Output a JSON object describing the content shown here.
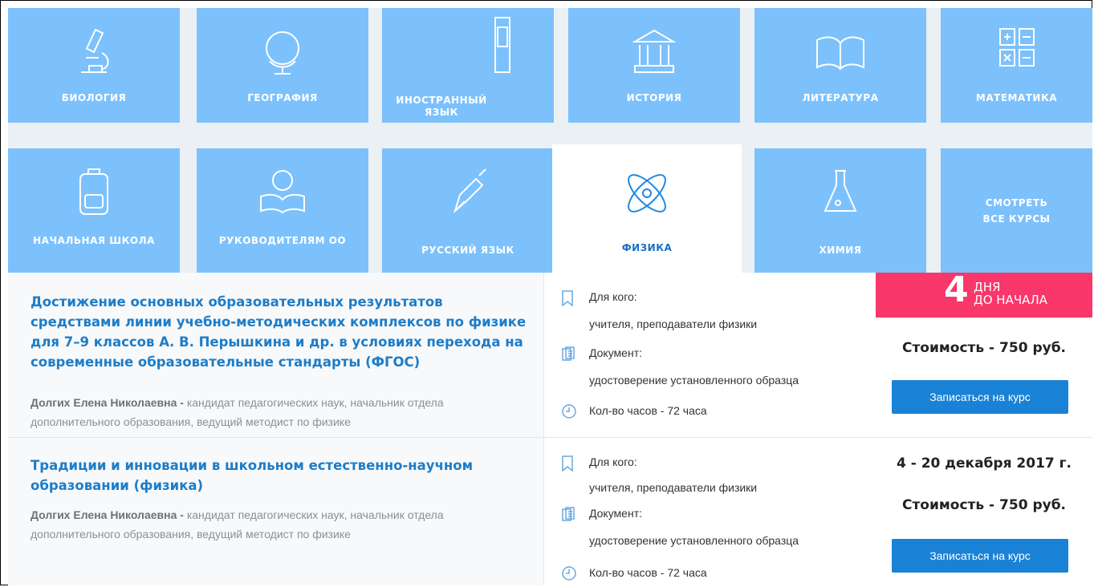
{
  "categories": [
    {
      "label": "БИОЛОГИЯ",
      "icon": "microscope-icon"
    },
    {
      "label": "ГЕОГРАФИЯ",
      "icon": "globe-icon"
    },
    {
      "label": "ИНОСТРАННЫЙ ЯЗЫК",
      "icon": "phone-booth-icon"
    },
    {
      "label": "ИСТОРИЯ",
      "icon": "museum-icon"
    },
    {
      "label": "ЛИТЕРАТУРА",
      "icon": "book-icon"
    },
    {
      "label": "МАТЕМАТИКА",
      "icon": "math-signs-icon"
    },
    {
      "label": "НАЧАЛЬНАЯ ШКОЛА",
      "icon": "backpack-icon"
    },
    {
      "label": "РУКОВОДИТЕЛЯМ ОО",
      "icon": "reader-icon"
    },
    {
      "label": "РУССКИЙ ЯЗЫК",
      "icon": "pen-nib-icon"
    },
    {
      "label": "ФИЗИКА",
      "icon": "atom-icon",
      "active": true
    },
    {
      "label": "ХИМИЯ",
      "icon": "flask-icon"
    },
    {
      "label": "СМОТРЕТЬ ВСЕ КУРСЫ",
      "icon": ""
    }
  ],
  "courses": [
    {
      "title": "Достижение основных образовательных результатов средствами линии учебно-методических комплексов по физике для 7–9 классов А. В. Перышкина и др. в условиях перехода на современные образовательные стандарты (ФГОС)",
      "author_name": "Долгих Елена Николаевна -",
      "author_desc": "кандидат педагогических наук, начальник отдела дополнительного образования, ведущий методист по физике",
      "for_whom_label": "Для кого:",
      "for_whom": "учителя, преподаватели физики",
      "doc_label": "Документ:",
      "doc": "удостоверение установленного образца",
      "hours": "Кол-во часов - 72 часа",
      "badge_num": "4",
      "badge_line1": "ДНЯ",
      "badge_line2": "ДО НАЧАЛА",
      "price": "Стоимость - 750 руб.",
      "button": "Записаться на курс"
    },
    {
      "title": "Традиции и инновации в школьном естественно-научном образовании (физика)",
      "author_name": "Долгих Елена Николаевна -",
      "author_desc": "кандидат педагогических наук, начальник отдела дополнительного образования, ведущий методист по физике",
      "for_whom_label": "Для кого:",
      "for_whom": "учителя, преподаватели физики",
      "doc_label": "Документ:",
      "doc": "удостоверение установленного образца",
      "hours": "Кол-во часов - 72 часа",
      "dates": "4 - 20 декабря 2017 г.",
      "price": "Стоимость - 750 руб.",
      "button": "Записаться на курс"
    }
  ],
  "colors": {
    "tile": "#7cc1fc",
    "accent": "#1d7dc8",
    "badge": "#f9376a",
    "button": "#1a82d6"
  }
}
